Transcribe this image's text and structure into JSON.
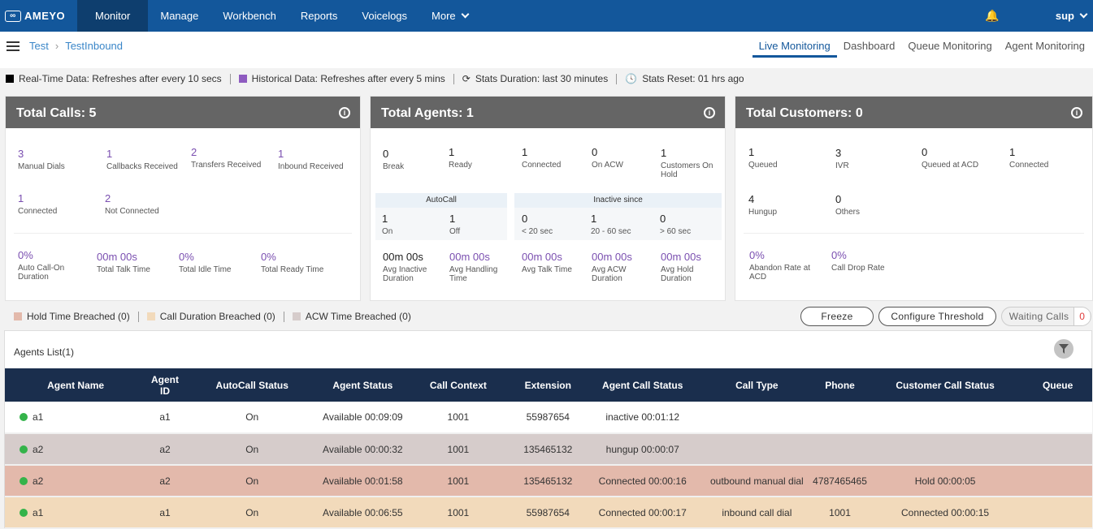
{
  "topnav": {
    "logo": "AMEYO",
    "items": [
      "Monitor",
      "Manage",
      "Workbench",
      "Reports",
      "Voicelogs",
      "More"
    ],
    "active": "Monitor",
    "user": "sup"
  },
  "breadcrumb": [
    "Test",
    "TestInbound"
  ],
  "tabs": [
    "Live Monitoring",
    "Dashboard",
    "Queue Monitoring",
    "Agent Monitoring"
  ],
  "infobar": {
    "realtime": "Real-Time Data: Refreshes after every 10 secs",
    "historical": "Historical Data: Refreshes after every 5 mins",
    "duration": "Stats Duration: last 30 minutes",
    "reset": "Stats Reset: 01 hrs ago",
    "colors": {
      "realtime": "#000000",
      "historical": "#8e5bc0"
    }
  },
  "calls": {
    "title": "Total Calls: 5",
    "stats": [
      {
        "value": "3",
        "label": "Manual Dials"
      },
      {
        "value": "1",
        "label": "Callbacks Received"
      },
      {
        "value": "2",
        "label": "Transfers Received"
      },
      {
        "value": "1",
        "label": "Inbound Received"
      },
      {
        "value": "1",
        "label": "Connected"
      },
      {
        "value": "2",
        "label": "Not Connected"
      }
    ],
    "bottom": [
      {
        "value": "0%",
        "label": "Auto Call-On Duration"
      },
      {
        "value": "00m 00s",
        "label": "Total Talk Time"
      },
      {
        "value": "0%",
        "label": "Total Idle Time"
      },
      {
        "value": "0%",
        "label": "Total Ready Time"
      }
    ]
  },
  "agents": {
    "title": "Total Agents: 1",
    "stats": [
      {
        "value": "0",
        "label": "Break"
      },
      {
        "value": "1",
        "label": "Ready"
      },
      {
        "value": "1",
        "label": "Connected"
      },
      {
        "value": "0",
        "label": "On ACW"
      },
      {
        "value": "1",
        "label": "Customers On Hold"
      }
    ],
    "autocall": {
      "title": "AutoCall",
      "on": {
        "value": "1",
        "label": "On"
      },
      "off": {
        "value": "1",
        "label": "Off"
      }
    },
    "inactive": {
      "title": "Inactive since",
      "items": [
        {
          "value": "0",
          "label": "< 20 sec"
        },
        {
          "value": "1",
          "label": "20 - 60 sec"
        },
        {
          "value": "0",
          "label": "> 60 sec"
        }
      ]
    },
    "bottom": [
      {
        "value": "00m 00s",
        "label": "Avg Inactive Duration"
      },
      {
        "value": "00m 00s",
        "label": "Avg Handling Time"
      },
      {
        "value": "00m 00s",
        "label": "Avg Talk Time"
      },
      {
        "value": "00m 00s",
        "label": "Avg ACW Duration"
      },
      {
        "value": "00m 00s",
        "label": "Avg Hold Duration"
      }
    ]
  },
  "customers": {
    "title": "Total Customers: 0",
    "stats": [
      {
        "value": "1",
        "label": "Queued"
      },
      {
        "value": "3",
        "label": "IVR"
      },
      {
        "value": "0",
        "label": "Queued at ACD"
      },
      {
        "value": "1",
        "label": "Connected"
      },
      {
        "value": "4",
        "label": "Hungup"
      },
      {
        "value": "0",
        "label": "Others"
      }
    ],
    "bottom": [
      {
        "value": "0%",
        "label": "Abandon Rate at ACD"
      },
      {
        "value": "0%",
        "label": "Call Drop Rate"
      }
    ]
  },
  "legend": [
    {
      "label": "Hold Time Breached (0)",
      "color": "#e3b9ab"
    },
    {
      "label": "Call Duration Breached (0)",
      "color": "#f2dabb"
    },
    {
      "label": "ACW Time Breached (0)",
      "color": "#d6cccb"
    }
  ],
  "buttons": {
    "freeze": "Freeze",
    "configure": "Configure Threshold",
    "waiting": "Waiting Calls",
    "waiting_count": "0"
  },
  "agents_list": {
    "title": "Agents List(1)",
    "columns": [
      "Agent Name",
      "Agent ID",
      "AutoCall Status",
      "Agent Status",
      "Call Context",
      "Extension",
      "Agent Call Status",
      "Call Type",
      "Phone",
      "Customer Call Status",
      "Queue"
    ],
    "rows": [
      {
        "color": "#ffffff",
        "cells": [
          "a1",
          "a1",
          "On",
          "Available  00:09:09",
          "1001",
          "55987654",
          "inactive 00:01:12",
          "",
          "",
          "",
          ""
        ]
      },
      {
        "color": "#d6cccb",
        "cells": [
          "a2",
          "a2",
          "On",
          "Available  00:00:32",
          "1001",
          "135465132",
          "hungup 00:00:07",
          "",
          "",
          "",
          ""
        ]
      },
      {
        "color": "#e3b9ab",
        "cells": [
          "a2",
          "a2",
          "On",
          "Available  00:01:58",
          "1001",
          "135465132",
          "Connected 00:00:16",
          "outbound manual dial",
          "4787465465",
          "Hold 00:00:05",
          ""
        ]
      },
      {
        "color": "#f2dabb",
        "cells": [
          "a1",
          "a1",
          "On",
          "Available  00:06:55",
          "1001",
          "55987654",
          "Connected 00:00:17",
          "inbound call dial",
          "1001",
          "Connected 00:00:15",
          ""
        ]
      }
    ]
  }
}
